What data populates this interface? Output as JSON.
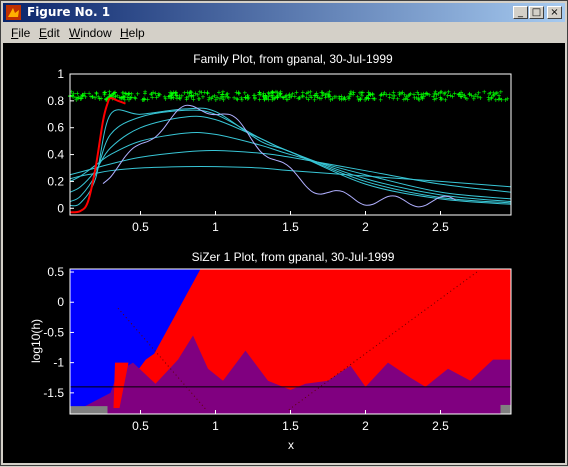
{
  "window": {
    "title": "Figure No. 1",
    "buttons": {
      "minimize": "_",
      "maximize": "□",
      "close": "×"
    }
  },
  "menu": {
    "items": [
      {
        "first": "F",
        "rest": "ile"
      },
      {
        "first": "E",
        "rest": "dit"
      },
      {
        "first": "W",
        "rest": "indow"
      },
      {
        "first": "H",
        "rest": "elp"
      }
    ]
  },
  "colors": {
    "background": "#000000",
    "axes": "#ffffff",
    "family_curves": "#38c6d6",
    "data_points": "#00ff00",
    "highlight_curve": "#ff0000",
    "sizer_increase": "#0000ff",
    "sizer_decrease": "#ff0000",
    "sizer_nonsig": "#800080",
    "sizer_sparse": "#808080"
  },
  "chart_data": [
    {
      "type": "line",
      "title": "Family Plot, from gpanal, 30-Jul-1999",
      "xlabel": "",
      "ylabel": "",
      "xlim": [
        0.03,
        2.97
      ],
      "ylim": [
        -0.05,
        1.0
      ],
      "xticks": [
        "0.5",
        "1",
        "1.5",
        "2",
        "2.5"
      ],
      "yticks": [
        "0",
        "0.2",
        "0.4",
        "0.6",
        "0.8",
        "1"
      ],
      "series": [
        {
          "role": "family",
          "x": [
            0.03,
            0.1,
            0.2,
            0.3,
            0.5,
            0.8,
            1.0,
            1.3,
            1.5,
            2.0,
            2.5,
            2.97
          ],
          "values": [
            0.22,
            0.24,
            0.26,
            0.28,
            0.3,
            0.31,
            0.31,
            0.3,
            0.28,
            0.24,
            0.2,
            0.16
          ]
        },
        {
          "role": "family",
          "x": [
            0.03,
            0.1,
            0.2,
            0.3,
            0.5,
            0.8,
            1.0,
            1.3,
            1.5,
            2.0,
            2.5,
            2.97
          ],
          "values": [
            0.25,
            0.27,
            0.3,
            0.33,
            0.38,
            0.42,
            0.43,
            0.41,
            0.38,
            0.28,
            0.18,
            0.12
          ]
        },
        {
          "role": "family",
          "x": [
            0.03,
            0.1,
            0.2,
            0.3,
            0.5,
            0.8,
            1.0,
            1.3,
            1.5,
            2.0,
            2.5,
            2.97
          ],
          "values": [
            0.2,
            0.24,
            0.32,
            0.4,
            0.5,
            0.56,
            0.55,
            0.47,
            0.4,
            0.25,
            0.12,
            0.07
          ]
        },
        {
          "role": "family",
          "x": [
            0.03,
            0.1,
            0.2,
            0.3,
            0.5,
            0.8,
            1.0,
            1.3,
            1.5,
            2.0,
            2.5,
            2.97
          ],
          "values": [
            0.12,
            0.16,
            0.28,
            0.45,
            0.6,
            0.68,
            0.66,
            0.52,
            0.42,
            0.22,
            0.1,
            0.05
          ]
        },
        {
          "role": "family",
          "x": [
            0.03,
            0.1,
            0.2,
            0.3,
            0.5,
            0.8,
            1.0,
            1.3,
            1.5,
            2.0,
            2.5,
            2.97
          ],
          "values": [
            0.05,
            0.09,
            0.25,
            0.55,
            0.68,
            0.73,
            0.7,
            0.52,
            0.42,
            0.2,
            0.08,
            0.04
          ]
        },
        {
          "role": "family",
          "x": [
            0.03,
            0.1,
            0.2,
            0.3,
            0.5,
            0.8,
            1.0,
            1.3,
            1.5,
            2.0,
            2.5,
            2.97
          ],
          "values": [
            0.02,
            0.04,
            0.22,
            0.7,
            0.7,
            0.74,
            0.72,
            0.5,
            0.42,
            0.18,
            0.07,
            0.03
          ]
        },
        {
          "role": "highlight",
          "x": [
            0.03,
            0.1,
            0.15,
            0.2,
            0.25,
            0.28,
            0.3,
            0.35,
            0.4
          ],
          "values": [
            -0.03,
            -0.02,
            0.05,
            0.3,
            0.65,
            0.78,
            0.82,
            0.8,
            0.78
          ]
        }
      ],
      "points": {
        "y_center": 0.84,
        "y_spread": 0.06,
        "x_range": [
          0.03,
          2.97
        ]
      }
    },
    {
      "type": "heatmap",
      "title": "SiZer 1 Plot, from gpanal, 30-Jul-1999",
      "xlabel": "x",
      "ylabel": "log10(h)",
      "xlim": [
        0.03,
        2.97
      ],
      "ylim": [
        -1.85,
        0.55
      ],
      "xticks": [
        "0.5",
        "1",
        "1.5",
        "2",
        "2.5"
      ],
      "yticks": [
        "0.5",
        "0",
        "-0.5",
        "-1",
        "-1.5"
      ],
      "reference_line_y": -1.4,
      "categories": [
        "increasing",
        "decreasing",
        "not significant",
        "sparse data"
      ]
    }
  ]
}
